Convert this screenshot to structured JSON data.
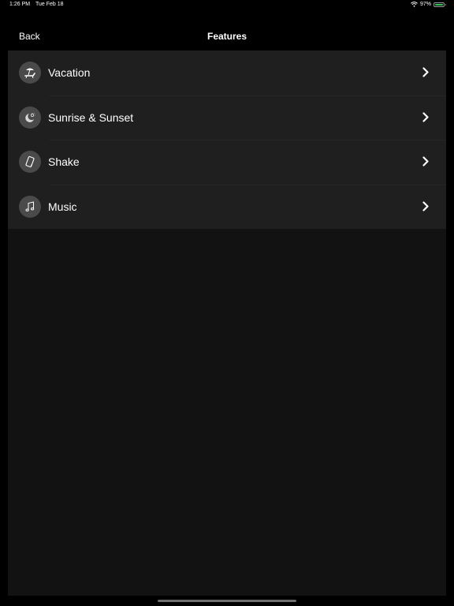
{
  "status_bar": {
    "time": "1:26 PM",
    "date": "Tue Feb 18",
    "battery_percent": "97%",
    "battery_level": 0.97
  },
  "nav": {
    "back_label": "Back",
    "title": "Features"
  },
  "features": [
    {
      "label": "Vacation",
      "icon": "beach-chair-icon"
    },
    {
      "label": "Sunrise & Sunset",
      "icon": "moon-sun-icon"
    },
    {
      "label": "Shake",
      "icon": "phone-shake-icon"
    },
    {
      "label": "Music",
      "icon": "music-note-icon"
    }
  ],
  "colors": {
    "background": "#000000",
    "list_background": "#1f1f1f",
    "content_background": "#121212",
    "icon_circle": "#4a4a4a",
    "battery": "#35c759"
  }
}
